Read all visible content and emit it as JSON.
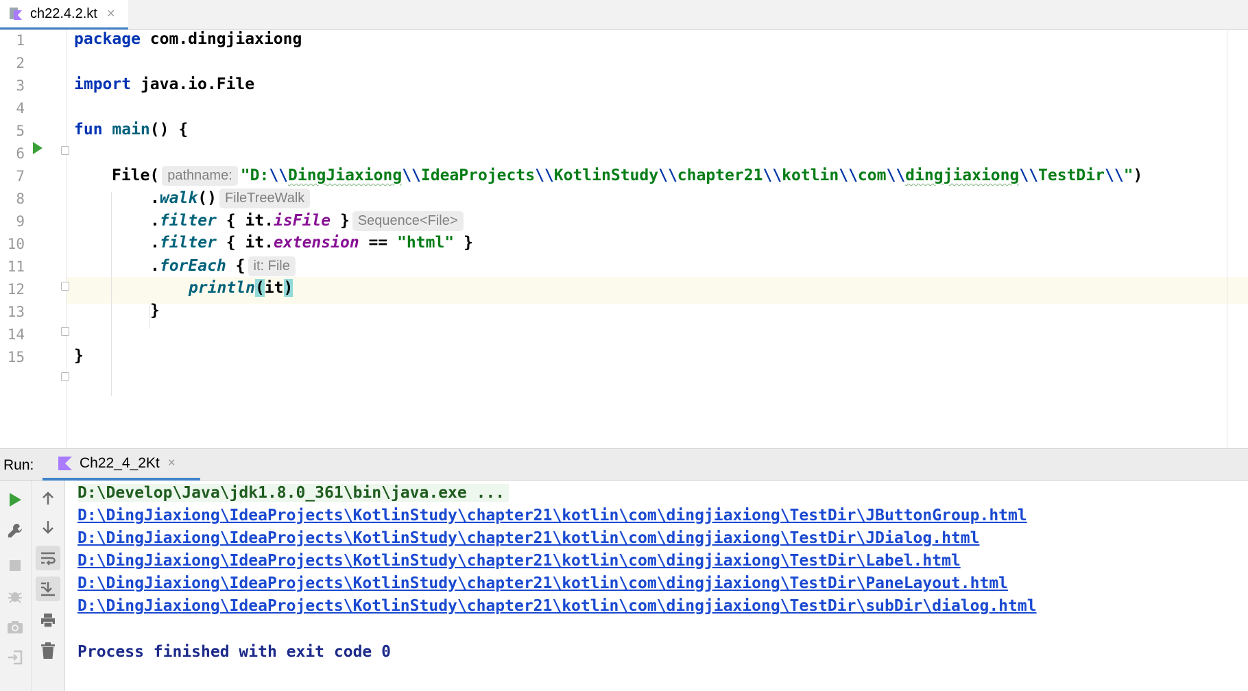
{
  "editor_tab": {
    "label": "ch22.4.2.kt",
    "close": "×"
  },
  "line_numbers": [
    "1",
    "2",
    "3",
    "4",
    "5",
    "6",
    "7",
    "8",
    "9",
    "10",
    "11",
    "12",
    "13",
    "14",
    "15"
  ],
  "code": {
    "l1": {
      "kw": "package",
      "text": " com.dingjiaxiong"
    },
    "l3": {
      "kw": "import",
      "text": " java.io.File"
    },
    "l5": {
      "kw": "fun",
      "fn": " main",
      "rest": "() {"
    },
    "l7": {
      "prefix": "File(",
      "hint": "pathname:",
      "q1": "\"D:",
      "bs": "\\\\",
      "seg1": "DingJiaxiong",
      "seg2": "IdeaProjects",
      "seg3": "KotlinStudy",
      "seg4": "chapter21",
      "seg5": "kotlin",
      "seg6": "com",
      "seg7": "dingjiaxiong",
      "seg8": "TestDir",
      "q2": "\"",
      "suffix": ")"
    },
    "l8": {
      "dot": ".",
      "fn": "walk",
      "rest": "()",
      "hint": "FileTreeWalk"
    },
    "l9": {
      "dot": ".",
      "fn": "filter",
      "open": " { it.",
      "prop": "isFile",
      "close": " }",
      "hint": "Sequence<File>"
    },
    "l10": {
      "dot": ".",
      "fn": "filter",
      "open": " { it.",
      "prop": "extension",
      "op": " == ",
      "str": "\"html\"",
      "close": " }"
    },
    "l11": {
      "dot": ".",
      "fn": "forEach",
      "open": " {",
      "hint": "it: File"
    },
    "l12": {
      "fn": "println",
      "lp": "(",
      "arg": "it",
      "rp": ")"
    },
    "l13": {
      "text": "}"
    },
    "l15": {
      "text": "}"
    }
  },
  "run": {
    "title": "Run:",
    "tab_label": "Ch22_4_2Kt",
    "tab_close": "×"
  },
  "toolbar_icons": [
    "run-icon",
    "wrench-icon",
    "stop-icon",
    "debug-icon",
    "camera-icon",
    "login-icon",
    "up-arrow-icon",
    "down-arrow-icon",
    "soft-wrap-icon",
    "scroll-to-end-icon",
    "print-icon",
    "trash-icon"
  ],
  "console": {
    "command": "D:\\Develop\\Java\\jdk1.8.0_361\\bin\\java.exe ...",
    "outputs": [
      "D:\\DingJiaxiong\\IdeaProjects\\KotlinStudy\\chapter21\\kotlin\\com\\dingjiaxiong\\TestDir\\JButtonGroup.html",
      "D:\\DingJiaxiong\\IdeaProjects\\KotlinStudy\\chapter21\\kotlin\\com\\dingjiaxiong\\TestDir\\JDialog.html",
      "D:\\DingJiaxiong\\IdeaProjects\\KotlinStudy\\chapter21\\kotlin\\com\\dingjiaxiong\\TestDir\\Label.html",
      "D:\\DingJiaxiong\\IdeaProjects\\KotlinStudy\\chapter21\\kotlin\\com\\dingjiaxiong\\TestDir\\PaneLayout.html",
      "D:\\DingJiaxiong\\IdeaProjects\\KotlinStudy\\chapter21\\kotlin\\com\\dingjiaxiong\\TestDir\\subDir\\dialog.html"
    ],
    "finish": "Process finished with exit code 0"
  },
  "colors": {
    "keyword": "#0033b3",
    "string": "#067d17",
    "link": "#1a49d1",
    "accent": "#4083c9",
    "run_green": "#3aa13a"
  }
}
